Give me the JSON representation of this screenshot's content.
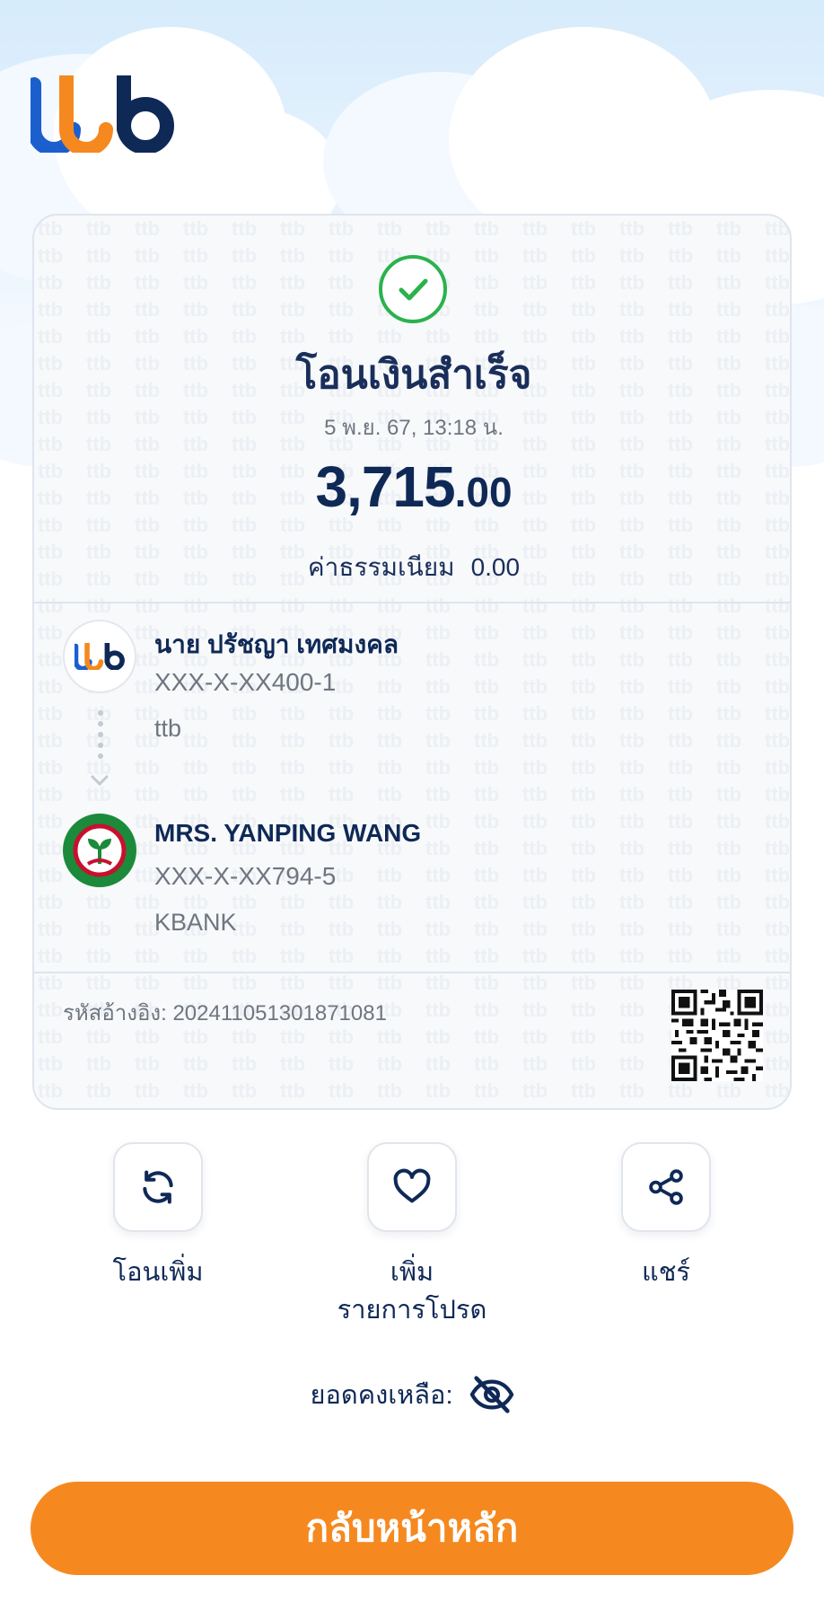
{
  "brand": {
    "logo_text": "ttb",
    "colors": {
      "navy": "#0f2957",
      "blue": "#1b5fcf",
      "orange": "#f5891f",
      "success": "#2bb24c",
      "kbank_green": "#1c8a3b"
    }
  },
  "receipt": {
    "status_icon": "check-circle-icon",
    "title": "โอนเงินสำเร็จ",
    "datetime": "5 พ.ย. 67, 13:18 น.",
    "amount_main": "3,715",
    "amount_decimal": ".00",
    "fee_label": "ค่าธรรมเนียม",
    "fee_value": "0.00",
    "sender": {
      "name": "นาย ปรัชญา เทศมงคล",
      "account": "XXX-X-XX400-1",
      "bank": "ttb"
    },
    "receiver": {
      "name": "MRS. YANPING WANG",
      "account": "XXX-X-XX794-5",
      "bank": "KBANK"
    },
    "reference_label": "รหัสอ้างอิง:",
    "reference_value": "20241105130187108​1"
  },
  "actions": [
    {
      "icon": "refresh-icon",
      "label": "โอนเพิ่ม"
    },
    {
      "icon": "heart-icon",
      "label_line1": "เพิ่ม",
      "label_line2": "รายการโปรด"
    },
    {
      "icon": "share-icon",
      "label": "แชร์"
    }
  ],
  "balance": {
    "label": "ยอดคงเหลือ:",
    "icon": "eye-off-icon"
  },
  "home_button": {
    "label": "กลับหน้าหลัก"
  }
}
